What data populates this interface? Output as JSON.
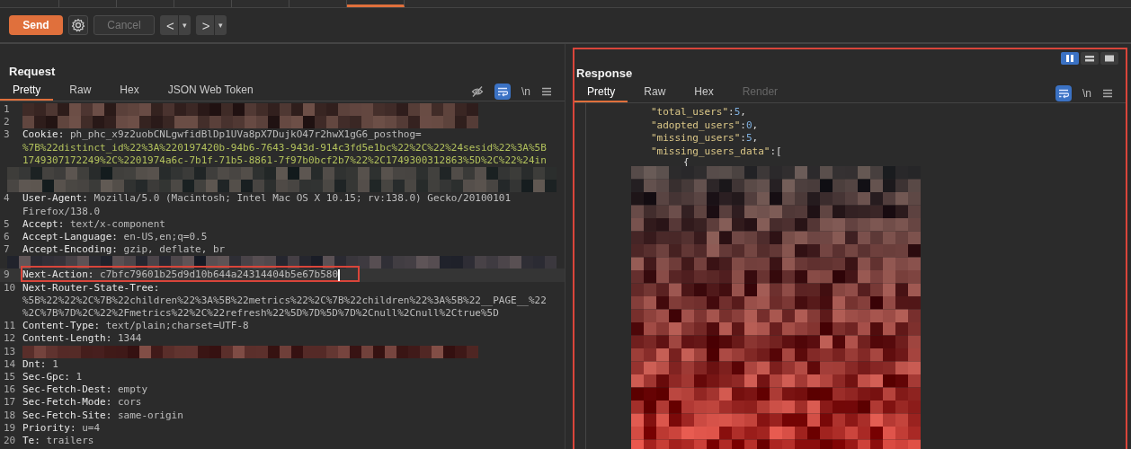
{
  "tab_strip": [
    {
      "selected": false
    },
    {
      "selected": false
    },
    {
      "selected": false
    },
    {
      "selected": false
    },
    {
      "selected": false
    },
    {
      "selected": false
    },
    {
      "selected": true
    }
  ],
  "toolbar": {
    "send": "Send",
    "cancel": {
      "label": "Cancel",
      "disabled": true
    },
    "back": {
      "label": "<",
      "menu": "▾"
    },
    "forward": {
      "label": ">",
      "menu": "▾"
    }
  },
  "request": {
    "title": "Request",
    "word_wrap": true,
    "newline_label": "\\n",
    "tabs": [
      {
        "label": "Pretty",
        "selected": true,
        "disabled": false
      },
      {
        "label": "Raw",
        "selected": false,
        "disabled": false
      },
      {
        "label": "Hex",
        "selected": false,
        "disabled": false
      },
      {
        "label": "JSON Web Token",
        "selected": false,
        "disabled": false
      }
    ],
    "lines": [
      {
        "kind": "redacted",
        "number": "1",
        "color": "#46302c"
      },
      {
        "kind": "redacted",
        "number": "2",
        "color": "#46302c"
      },
      {
        "kind": "header",
        "number": "3",
        "name": "Cookie:",
        "value": "ph_phc_x9z2uobCNLgwfidBlDp1UVa8pX7DujkO47r2hwX1gG6_posthog="
      },
      {
        "kind": "continuation",
        "color": "#b3c25c",
        "text": "%7B%22distinct_id%22%3A%220197420b-94b6-7643-943d-914c3fd5e1bc%22%2C%22%24sesid%22%3A%5B"
      },
      {
        "kind": "continuation",
        "color": "#b3c25c",
        "text": "1749307172249%2C%2201974a6c-7b1f-71b5-8861-7f97b0bcf2b7%22%2C1749300312863%5D%2C%22%24in"
      },
      {
        "kind": "redacted",
        "color": "#3a3a38"
      },
      {
        "kind": "redacted",
        "color": "#3a3a38"
      },
      {
        "kind": "header",
        "number": "4",
        "name": "User-Agent:",
        "value": "Mozilla/5.0 (Macintosh; Intel Mac OS X 10.15; rv:138.0) Gecko/20100101"
      },
      {
        "kind": "continuation",
        "color": "#bdbdbd",
        "text": "Firefox/138.0"
      },
      {
        "kind": "header",
        "number": "5",
        "name": "Accept:",
        "value": "text/x-component"
      },
      {
        "kind": "header",
        "number": "6",
        "name": "Accept-Language:",
        "value": "en-US,en;q=0.5"
      },
      {
        "kind": "header",
        "number": "7",
        "name": "Accept-Encoding:",
        "value": "gzip, deflate, br"
      },
      {
        "kind": "redacted",
        "color": "#3e3a40"
      },
      {
        "kind": "header",
        "number": "9",
        "name": "Next-Action:",
        "value": "c7bfc79601b25d9d10b644a24314404b5e67b580",
        "highlighted": true,
        "annotated": true,
        "cursor": true
      },
      {
        "kind": "header",
        "number": "10",
        "name": "Next-Router-State-Tree:"
      },
      {
        "kind": "continuation",
        "color": "#bdbdbd",
        "text": "%5B%22%22%2C%7B%22children%22%3A%5B%22metrics%22%2C%7B%22children%22%3A%5B%22__PAGE__%22"
      },
      {
        "kind": "continuation",
        "color": "#bdbdbd",
        "text": "%2C%7B%7D%2C%22%2Fmetrics%22%2C%22refresh%22%5D%7D%5D%7D%2Cnull%2Cnull%2Ctrue%5D"
      },
      {
        "kind": "header",
        "number": "11",
        "name": "Content-Type:",
        "value": "text/plain;charset=UTF-8"
      },
      {
        "kind": "header",
        "number": "12",
        "name": "Content-Length:",
        "value": "1344"
      },
      {
        "kind": "redacted",
        "number": "13",
        "color": "#5c302c"
      },
      {
        "kind": "header",
        "number": "14",
        "name": "Dnt:",
        "value": "1"
      },
      {
        "kind": "header",
        "number": "15",
        "name": "Sec-Gpc:",
        "value": "1"
      },
      {
        "kind": "header",
        "number": "16",
        "name": "Sec-Fetch-Dest:",
        "value": "empty"
      },
      {
        "kind": "header",
        "number": "17",
        "name": "Sec-Fetch-Mode:",
        "value": "cors"
      },
      {
        "kind": "header",
        "number": "18",
        "name": "Sec-Fetch-Site:",
        "value": "same-origin"
      },
      {
        "kind": "header",
        "number": "19",
        "name": "Priority:",
        "value": "u=4"
      },
      {
        "kind": "header",
        "number": "20",
        "name": "Te:",
        "value": "trailers"
      }
    ]
  },
  "response": {
    "title": "Response",
    "annotated": true,
    "word_wrap": true,
    "newline_label": "\\n",
    "layouts": [
      {
        "selected": true
      },
      {
        "selected": false
      },
      {
        "selected": false
      }
    ],
    "tabs": [
      {
        "label": "Pretty",
        "selected": true,
        "disabled": false
      },
      {
        "label": "Raw",
        "selected": false,
        "disabled": false
      },
      {
        "label": "Hex",
        "selected": false,
        "disabled": false
      },
      {
        "label": "Render",
        "selected": false,
        "disabled": true
      }
    ],
    "lines": [
      {
        "kind": "pair",
        "key": "\"total_users\"",
        "colon": ":",
        "value": "5",
        "comma": ","
      },
      {
        "kind": "pair",
        "key": "\"adopted_users\"",
        "colon": ":",
        "value": "0",
        "comma": ","
      },
      {
        "kind": "pair",
        "key": "\"missing_users\"",
        "colon": ":",
        "value": "5",
        "comma": ","
      },
      {
        "kind": "open",
        "key": "\"missing_users_data\"",
        "colon": ":",
        "value": "["
      },
      {
        "kind": "brace",
        "text": "{"
      },
      {
        "kind": "redacted"
      }
    ]
  }
}
